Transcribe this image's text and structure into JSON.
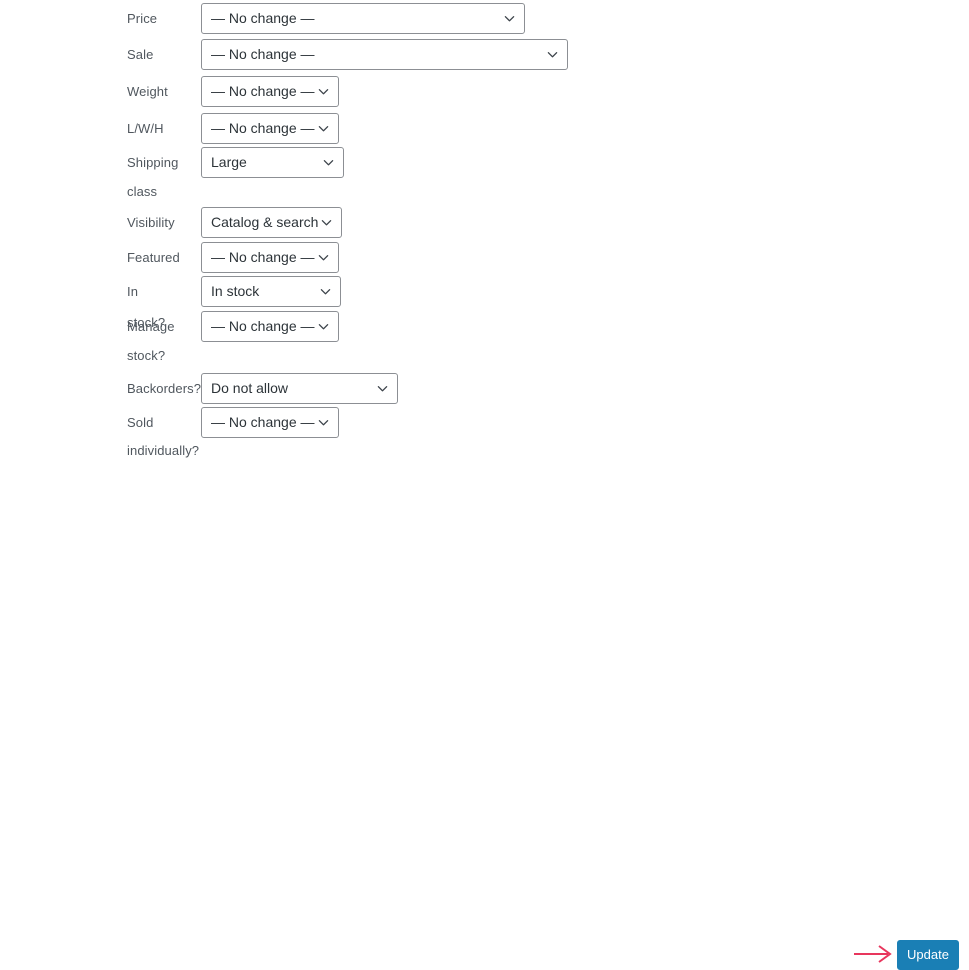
{
  "form": {
    "name": "product-bulk-edit",
    "rows": [
      {
        "label": "Price",
        "label_line2": "",
        "value": "— No change —",
        "width_class": "w-price"
      },
      {
        "label": "Sale",
        "label_line2": "",
        "value": "— No change —",
        "width_class": "w-sale"
      },
      {
        "label": "Weight",
        "label_line2": "",
        "value": "— No change —",
        "width_class": "w-small"
      },
      {
        "label": "L/W/H",
        "label_line2": "",
        "value": "— No change —",
        "width_class": "w-small"
      },
      {
        "label": "Shipping",
        "label_line2": "class",
        "value": "Large",
        "width_class": "w-shipclass"
      },
      {
        "label": "Visibility",
        "label_line2": "",
        "value": "Catalog & search",
        "width_class": "w-visibility"
      },
      {
        "label": "Featured",
        "label_line2": "",
        "value": "— No change —",
        "width_class": "w-small"
      },
      {
        "label": "In stock?",
        "label_line2": "",
        "value": "In stock",
        "width_class": "w-instock"
      },
      {
        "label": "Manage",
        "label_line2": "stock?",
        "value": "— No change —",
        "width_class": "w-small"
      },
      {
        "label": "Backorders?",
        "label_line2": "",
        "value": "Do not allow",
        "width_class": "w-backorder"
      },
      {
        "label": "Sold",
        "label_line2": "individually?",
        "value": "— No change —",
        "width_class": "w-small"
      }
    ]
  },
  "actions": {
    "update_label": "Update",
    "arrow_icon": "arrow-right-icon"
  },
  "colors": {
    "button_blue": "#1a7fb5",
    "arrow_pink": "#e8365d",
    "select_border": "#8c8f94",
    "label_text": "#50575e",
    "value_text": "#2c3338",
    "background": "#ffffff"
  }
}
